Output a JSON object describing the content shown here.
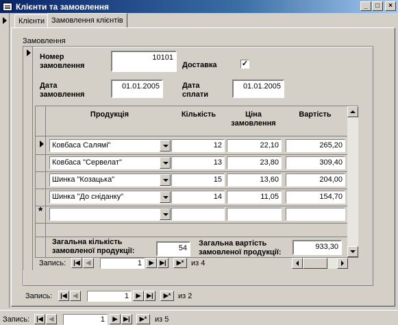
{
  "window": {
    "title": "Клієнти та замовлення",
    "controls": [
      "_",
      "□",
      "×"
    ]
  },
  "tabs": [
    {
      "label": "Клієнти",
      "active": false
    },
    {
      "label": "Замовлення клієнтів",
      "active": true
    }
  ],
  "orders": {
    "frame_label": "Замовлення",
    "order_number_label": "Номер замовлення",
    "order_number": "10101",
    "delivery_label": "Доставка",
    "delivery_checked": true,
    "order_date_label": "Дата замовлення",
    "order_date": "01.01.2005",
    "payment_date_label": "Дата сплати",
    "payment_date": "01.01.2005"
  },
  "items": {
    "columns": [
      "Продукція",
      "Кількість",
      "Ціна замовлення",
      "Вартість"
    ],
    "rows": [
      {
        "product": "Ковбаса Салямі\"",
        "qty": "12",
        "price": "22,10",
        "total": "265,20"
      },
      {
        "product": "Ковбаса \"Сервелат\"",
        "qty": "13",
        "price": "23,80",
        "total": "309,40"
      },
      {
        "product": "Шинка \"Козацька\"",
        "qty": "15",
        "price": "13,60",
        "total": "204,00"
      },
      {
        "product": "Шинка \"До сніданку\"",
        "qty": "14",
        "price": "11,05",
        "total": "154,70"
      }
    ],
    "new_row_marker": "*",
    "total_qty_label": "Загальна кількість замовленої продукції:",
    "total_qty": "54",
    "total_value_label": "Загальна вартість замовленої продукції:",
    "total_value": "933,30"
  },
  "nav_items": {
    "label": "Запись:",
    "current": "1",
    "of_label": "из",
    "total": "4"
  },
  "nav_orders": {
    "label": "Запись:",
    "current": "1",
    "of_label": "из",
    "total": "2"
  },
  "nav_main": {
    "label": "Запись:",
    "current": "1",
    "of_label": "из",
    "total": "5"
  },
  "colors": {
    "titlebar_start": "#0a246a",
    "titlebar_end": "#a6caf0",
    "face": "#d4d0c8"
  }
}
